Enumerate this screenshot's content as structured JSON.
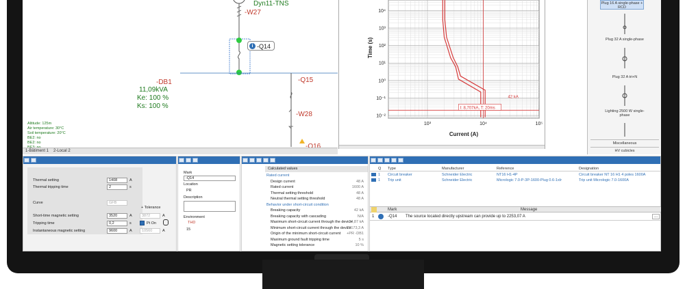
{
  "schematic": {
    "transformer_label": "Dyn11-TNS",
    "w27": "-W27",
    "q14_badge": "-Q14",
    "q15": "-Q15",
    "w28": "-W28",
    "q16": "-Q16",
    "db1": "-DB1",
    "power": "11,09kVA",
    "ke": "Ke: 100 %",
    "ks": "Ks: 100 %",
    "env_lines": [
      "Altitude: 125m",
      "Air temperature: 30°C",
      "Soil temperature: 20°C",
      "BE2: no",
      "BE2: no",
      "BE3: no"
    ],
    "tabs": [
      "1-Bâtiment 1",
      "2-Local 2"
    ]
  },
  "chart_data": {
    "type": "line",
    "xlabel": "Current (A)",
    "ylabel": "Time (s)",
    "x_scale": "log",
    "y_scale": "log",
    "xlim": [
      200,
      100000
    ],
    "ylim": [
      0.007,
      40000
    ],
    "x_tick_labels": [
      "10³",
      "10⁴",
      "10⁵"
    ],
    "y_tick_labels": [
      "10⁴",
      "10³",
      "10²",
      "10¹",
      "10⁰",
      "10⁻¹",
      "10⁻²"
    ],
    "annotation_current": "I: 8,707kA, T: 20ms",
    "annotation_tag": "42 kA",
    "series": [
      {
        "points": [
          [
            1880,
            40000
          ],
          [
            1880,
            3000
          ],
          [
            2000,
            300
          ],
          [
            2600,
            20
          ],
          [
            3200,
            6
          ],
          [
            3600,
            1.2
          ],
          [
            9000,
            0.22
          ],
          [
            9000,
            0.008
          ]
        ]
      },
      {
        "points": [
          [
            2050,
            40000
          ],
          [
            2050,
            3000
          ],
          [
            2200,
            300
          ],
          [
            2900,
            20
          ],
          [
            3500,
            6
          ],
          [
            3900,
            1.8
          ],
          [
            10800,
            0.28
          ],
          [
            10800,
            0.008
          ]
        ]
      }
    ],
    "markers": {
      "x_vertical": 10000,
      "y_horizontal": 0.02
    },
    "grid": true
  },
  "library": {
    "items": [
      {
        "label": "Plug 16 A single-phase + RCD"
      },
      {
        "label": "Plug 32 A single-phase"
      },
      {
        "label": "Plug 32 A tri+N"
      },
      {
        "label": "Lighting 2500 W single-phase"
      }
    ],
    "categories": [
      "Miscellaneous",
      "HV cubicles"
    ]
  },
  "settings": {
    "thermal_setting": {
      "label": "Thermal setting",
      "value": "1408",
      "unit": "A"
    },
    "thermal_tripping_time": {
      "label": "Thermal tripping time",
      "value": "2",
      "unit": "s"
    },
    "curve": {
      "label": "Curve",
      "value": "GFB"
    },
    "tolerance_label": "+ Tolerance",
    "short_time": {
      "label": "Short-time magnetic setting",
      "value": "3520",
      "unit": "A",
      "tol_value": "3872",
      "tol_unit": "A"
    },
    "tripping_time": {
      "label": "Tripping time",
      "value": "0,2",
      "unit": "s",
      "pt_on": "Pt On"
    },
    "instantaneous": {
      "label": "Instantaneous magnetic setting",
      "value": "9600",
      "unit": "A",
      "tol_value": "10560",
      "tol_unit": "A"
    }
  },
  "properties": {
    "mark_label": "Mark",
    "mark_value": "-Q14",
    "location_label": "Location",
    "location_value": "PR",
    "description_label": "Description",
    "environment_label": "Environment",
    "thd_label": "THD",
    "env_value": "15"
  },
  "calculated": {
    "header": "Calculated values",
    "rated_section": "Rated current",
    "rated_rows": [
      {
        "k": "Design current",
        "v": "48 A"
      },
      {
        "k": "Rated current",
        "v": "1600 A"
      },
      {
        "k": "Thermal setting threshold",
        "v": "48 A"
      },
      {
        "k": "Neutral thermal setting threshold",
        "v": "48 A"
      }
    ],
    "sc_section": "Behavior under short-circuit condition",
    "sc_rows": [
      {
        "k": "Breaking capacity",
        "v": "42 kA"
      },
      {
        "k": "Breaking capacity with cascading",
        "v": "N/A"
      },
      {
        "k": "Maximum short-circuit current through the device",
        "v": "34,87 kA"
      },
      {
        "k": "Minimum short-circuit current through the device",
        "v": "23173,3 A"
      },
      {
        "k": "Origin of the minimum short-circuit current",
        "v": "+PR -DB1"
      },
      {
        "k": "Maximum ground fault tripping time",
        "v": "5 s"
      },
      {
        "k": "Magnetic setting tolerance",
        "v": "10 %"
      }
    ]
  },
  "components": {
    "columns": [
      "Q",
      "Type",
      "Manufacturer",
      "Reference",
      "Designation"
    ],
    "rows": [
      {
        "q": "1",
        "type": "Circuit breaker",
        "manufacturer": "Schneider Electric",
        "reference": "NT16 H1-4P",
        "designation": "Circuit breaker NT 16 H1 4 poles 1600A"
      },
      {
        "q": "1",
        "type": "Trip unit",
        "manufacturer": "Schneider Electric",
        "reference": "Micrologic 7.0-P-3P-1600-Plug 0.6-1xIr",
        "designation": "Trip unit Micrologic 7.0-1600A"
      }
    ]
  },
  "messages": {
    "columns": [
      "Mark",
      "Message"
    ],
    "rows": [
      {
        "n": "1",
        "mark": "-Q14",
        "message": "The source located directly upstream can provide up to 2253,07 A",
        "more": "..."
      }
    ]
  }
}
